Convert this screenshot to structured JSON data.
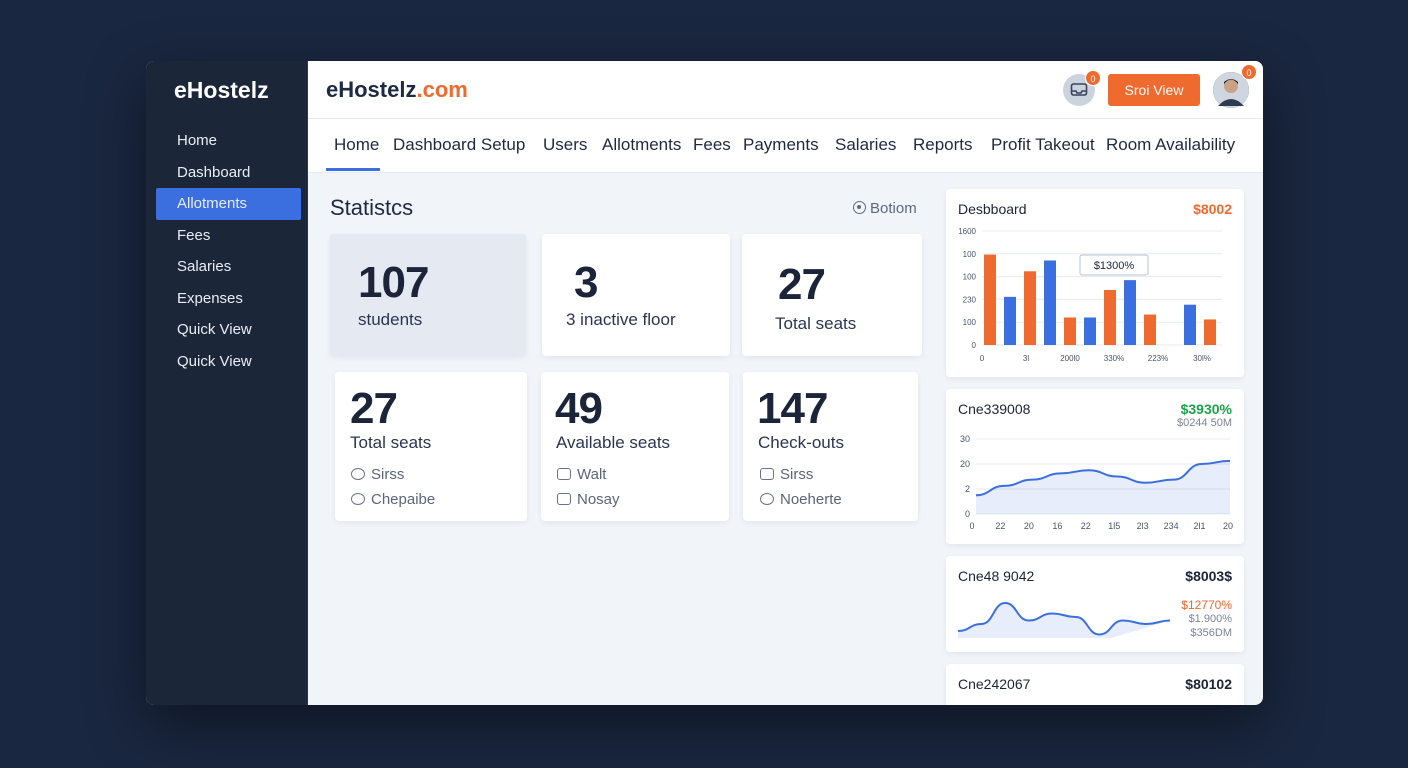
{
  "sidebar": {
    "logo": "eHostelz",
    "items": [
      {
        "label": "Home"
      },
      {
        "label": "Dashboard"
      },
      {
        "label": "Allotments",
        "active": true
      },
      {
        "label": "Fees"
      },
      {
        "label": "Salaries"
      },
      {
        "label": "Expenses"
      },
      {
        "label": "Quick View"
      },
      {
        "label": "Quick View"
      }
    ]
  },
  "header": {
    "brand_name": "eHostelz",
    "brand_suffix": ".com",
    "notification_count": "0",
    "quick_view_label": "Sroi View",
    "avatar_badge": "0"
  },
  "tabs": [
    "Home",
    "Dashboard Setup",
    "Users",
    "Allotments",
    "Fees",
    "Payments",
    "Salaries",
    "Reports",
    "Profit Takeout",
    "Room Availability"
  ],
  "statistics": {
    "title": "Statistcs",
    "bottom_link": "Botiom",
    "cards": [
      {
        "value": "107",
        "label": "students"
      },
      {
        "value": "3",
        "label": "3 inactive floor"
      },
      {
        "value": "27",
        "label": "Total seats"
      },
      {
        "value": "27",
        "label": "Total seats",
        "sub1": "Sirss",
        "sub2": "Chepaibe"
      },
      {
        "value": "49",
        "label": "Available seats",
        "sub1": "Walt",
        "sub2": "Nosay"
      },
      {
        "value": "147",
        "label": "Check-outs",
        "sub1": "Sirss",
        "sub2": "Noeherte"
      }
    ]
  },
  "panels": {
    "p1": {
      "title": "Desbboard",
      "value": "$8002"
    },
    "p2": {
      "title": "Cne339008",
      "value": "$3930%",
      "sub": "$0244 50M"
    },
    "p3": {
      "title": "Cne48 9042",
      "value": "$8003$",
      "sub1": "$12770%",
      "sub2": "$1.900%",
      "sub3": "$356DM"
    },
    "p4": {
      "title": "Cne242067",
      "value": "$80102"
    }
  },
  "colors": {
    "accent": "#3b6fe0",
    "orange": "#ef6a2f",
    "green": "#1aa34a",
    "sidebar": "#1b2638"
  },
  "chart_data": [
    {
      "type": "bar",
      "title": "Desbboard",
      "y_tick_labels": [
        "0",
        "100",
        "230",
        "100",
        "100",
        "1600"
      ],
      "x_tick_labels": [
        "0",
        "3l",
        "200l0",
        "330%",
        "223%",
        "30l%"
      ],
      "annotation": "$1300%",
      "series": [
        {
          "color": "#ef6a2f",
          "values": [
            920,
            0,
            750,
            0,
            280,
            0,
            560,
            0,
            310,
            0,
            0,
            260
          ]
        },
        {
          "color": "#3b6fe0",
          "values": [
            0,
            490,
            0,
            860,
            0,
            280,
            0,
            660,
            0,
            0,
            410,
            0
          ]
        }
      ],
      "ylim": [
        0,
        1160
      ]
    },
    {
      "type": "area",
      "title": "Cne339008",
      "y_tick_labels": [
        "0",
        "2",
        "20",
        "30"
      ],
      "x_tick_labels": [
        "0",
        "22",
        "20",
        "16",
        "22",
        "1l5",
        "2l3",
        "234",
        "2l1",
        "20"
      ],
      "y": [
        6,
        9,
        11,
        13,
        14,
        12,
        10,
        11,
        16,
        17
      ],
      "ylim": [
        0,
        24
      ]
    },
    {
      "type": "area",
      "title": "Cne48 9042",
      "y": [
        2,
        4,
        10,
        5,
        7,
        6,
        1,
        5,
        4,
        5
      ],
      "ylim": [
        0,
        12
      ]
    }
  ]
}
